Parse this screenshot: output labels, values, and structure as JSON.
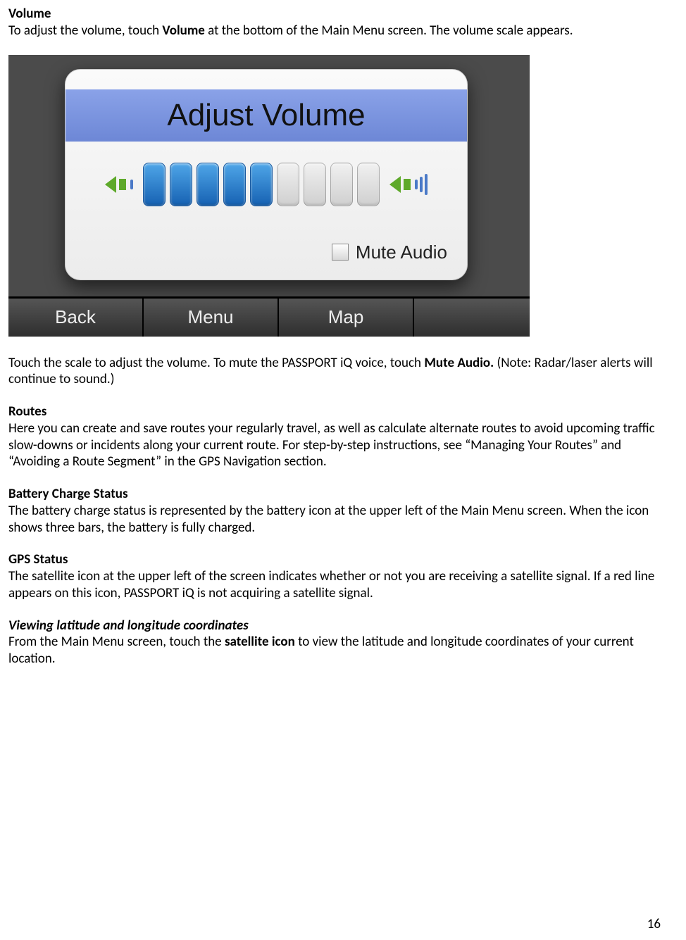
{
  "section_volume": {
    "heading": "Volume",
    "intro_before": "To adjust the volume, touch ",
    "intro_bold": "Volume",
    "intro_after": " at the bottom of the Main Menu screen. The volume scale appears.",
    "after_before": "Touch the scale to adjust the volume. To mute the PASSPORT iQ voice, touch ",
    "after_bold": "Mute Audio.",
    "after_after": " (Note: Radar/laser alerts will continue to sound.)"
  },
  "screenshot": {
    "panel_title": "Adjust Volume",
    "mute_label": "Mute Audio",
    "buttons": {
      "back": "Back",
      "menu": "Menu",
      "map": "Map"
    },
    "volume_level": 5,
    "volume_max": 9,
    "muted": false
  },
  "section_routes": {
    "heading": "Routes",
    "body": "Here you can create and save routes your regularly travel, as well as calculate alternate routes to avoid upcoming traffic slow-downs or incidents along your current route. For step-by-step instructions, see “Managing Your Routes” and “Avoiding a Route Segment” in the GPS Navigation section."
  },
  "section_battery": {
    "heading": "Battery Charge Status",
    "body": "The battery charge status is represented by the battery icon at the upper left of the Main Menu screen. When the icon shows three bars, the battery is fully charged."
  },
  "section_gps": {
    "heading": "GPS Status",
    "body": "The satellite icon at the upper left of the screen indicates whether or not you are receiving a satellite signal. If a red line appears on this icon, PASSPORT iQ is not acquiring a satellite signal."
  },
  "section_coords": {
    "heading": "Viewing latitude and longitude coordinates",
    "before": "From the Main Menu screen, touch the ",
    "bold": "satellite icon",
    "after": " to view the latitude and longitude coordinates of your current location."
  },
  "page_number": "16"
}
